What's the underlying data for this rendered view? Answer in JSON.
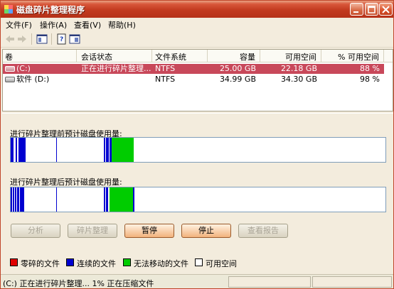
{
  "window": {
    "title": "磁盘碎片整理程序",
    "menu": [
      "文件(F)",
      "操作(A)",
      "查看(V)",
      "帮助(H)"
    ]
  },
  "list": {
    "columns": [
      "卷",
      "会话状态",
      "文件系统",
      "容量",
      "可用空间",
      "% 可用空间"
    ],
    "rows": [
      {
        "volume": "(C:)",
        "status": "正在进行碎片整理...",
        "fs": "NTFS",
        "capacity": "25.00 GB",
        "free": "22.18 GB",
        "pct": "88 %",
        "selected": true
      },
      {
        "volume": "软件 (D:)",
        "status": "",
        "fs": "NTFS",
        "capacity": "34.99 GB",
        "free": "34.30 GB",
        "pct": "98 %",
        "selected": false
      }
    ]
  },
  "analysis": {
    "before_label": "进行碎片整理前预计磁盘使用量:",
    "after_label": "进行碎片整理后预计磁盘使用量:"
  },
  "buttons": {
    "analyze": "分析",
    "defragment": "碎片整理",
    "pause": "暂停",
    "stop": "停止",
    "view_report": "查看报告"
  },
  "legend": [
    {
      "label": "零碎的文件",
      "color": "#e00000"
    },
    {
      "label": "连续的文件",
      "color": "#0000d0"
    },
    {
      "label": "无法移动的文件",
      "color": "#00cc00"
    },
    {
      "label": "可用空间",
      "color": "#ffffff"
    }
  ],
  "status": {
    "text": "(C:) 正在进行碎片整理... 1%  正在压缩文件"
  },
  "colors": {
    "title_accent": "#c23a1f",
    "selection": "#c8485a",
    "contiguous": "#0000d0",
    "unmovable": "#00cc00"
  }
}
